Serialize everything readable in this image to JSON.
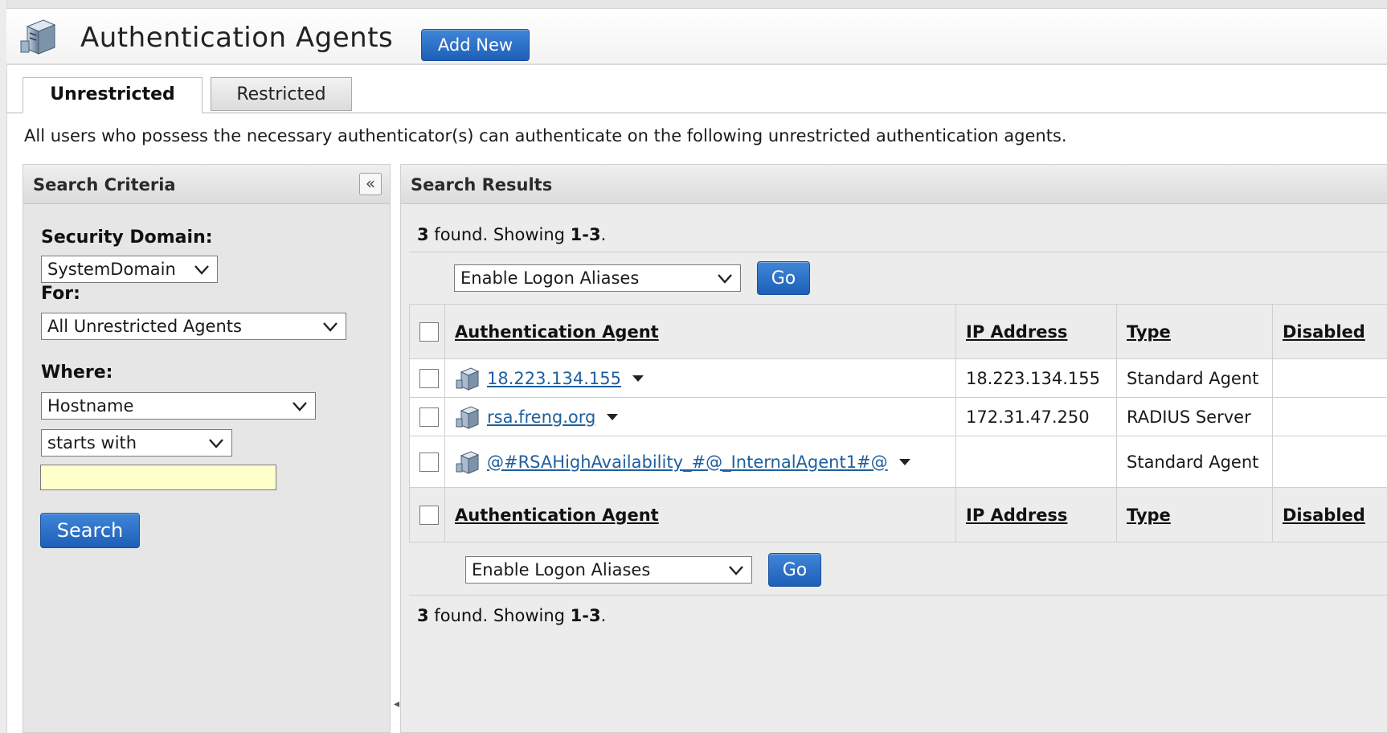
{
  "header": {
    "title": "Authentication Agents",
    "add_new_label": "Add New"
  },
  "tabs": [
    {
      "label": "Unrestricted",
      "active": true
    },
    {
      "label": "Restricted",
      "active": false
    }
  ],
  "intro_text": "All users who possess the necessary authenticator(s) can authenticate on the following unrestricted authentication agents.",
  "criteria": {
    "title": "Search Criteria",
    "collapse_glyph": "«",
    "security_domain_label": "Security Domain:",
    "security_domain_value": "SystemDomain",
    "for_label": "For:",
    "for_value": "All Unrestricted Agents",
    "where_label": "Where:",
    "where_field_value": "Hostname",
    "where_operator_value": "starts with",
    "search_text_value": "",
    "search_label": "Search"
  },
  "results": {
    "title": "Search Results",
    "summary": {
      "count": "3",
      "found_text": " found. Showing ",
      "range": "1-3",
      "period": "."
    },
    "action_select_value": "Enable Logon Aliases",
    "go_label": "Go",
    "columns": [
      "Authentication Agent",
      "IP Address",
      "Type",
      "Disabled"
    ],
    "rows": [
      {
        "name": "18.223.134.155",
        "ip": "18.223.134.155",
        "type": "Standard Agent",
        "disabled": ""
      },
      {
        "name": "rsa.freng.org",
        "ip": "172.31.47.250",
        "type": "RADIUS Server",
        "disabled": ""
      },
      {
        "name": "@#RSAHighAvailability_#@_InternalAgent1#@",
        "ip": "",
        "type": "Standard Agent",
        "disabled": ""
      }
    ]
  },
  "colors": {
    "accent": "#1e5fb8",
    "link": "#1f5f9e",
    "input_highlight": "#ffffcc"
  },
  "icons": [
    "server-agent-icon",
    "chevron-down-icon",
    "collapse-left-icon",
    "row-menu-caret-icon"
  ]
}
